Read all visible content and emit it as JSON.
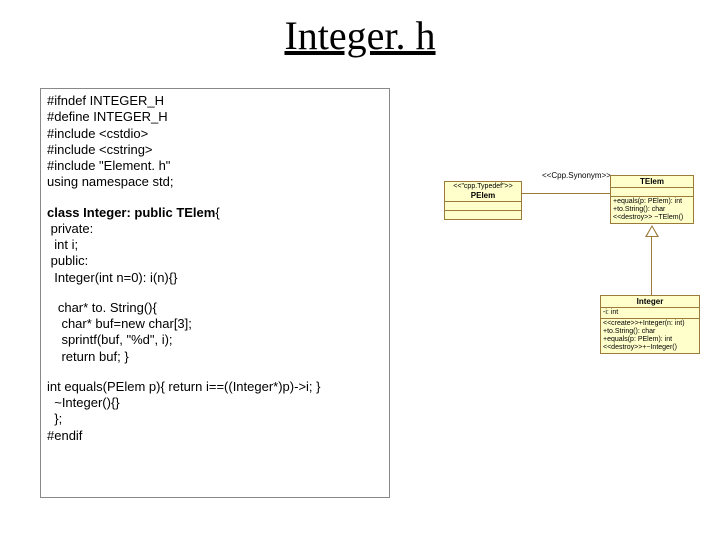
{
  "title": "Integer. h",
  "code": {
    "block1": "#ifndef INTEGER_H\n#define INTEGER_H\n#include <cstdio>\n#include <cstring>\n#include \"Element. h\"\nusing namespace std;",
    "classHead": "class Integer: public TElem",
    "block2": "{\n private:\n  int i;\n public:\n  Integer(int n=0): i(n){}",
    "block3": "   char* to. String(){\n    char* buf=new char[3];\n    sprintf(buf, \"%d\", i);\n    return buf; }",
    "block4": "int equals(PElem p){ return i==((Integer*)p)->i; }\n  ~Integer(){}\n  };\n#endif"
  },
  "uml": {
    "cppSynonymLabel": "<<Cpp.Synonym>>",
    "pelem": {
      "stereo": "<<\"cpp.Typedef\">>",
      "name": "PElem"
    },
    "telem": {
      "name": "TElem",
      "ops1": "+equals(p: PElem): int",
      "ops2": "+to.String(): char",
      "ops3": "<<destroy>> ~TElem()"
    },
    "integer": {
      "name": "Integer",
      "attr": "-i: int",
      "op1": "<<create>>+Integer(n: int)",
      "op2": "+to.String(): char",
      "op3": "+equals(p: PElem): int",
      "op4": "<<destroy>>+~Integer()"
    }
  }
}
